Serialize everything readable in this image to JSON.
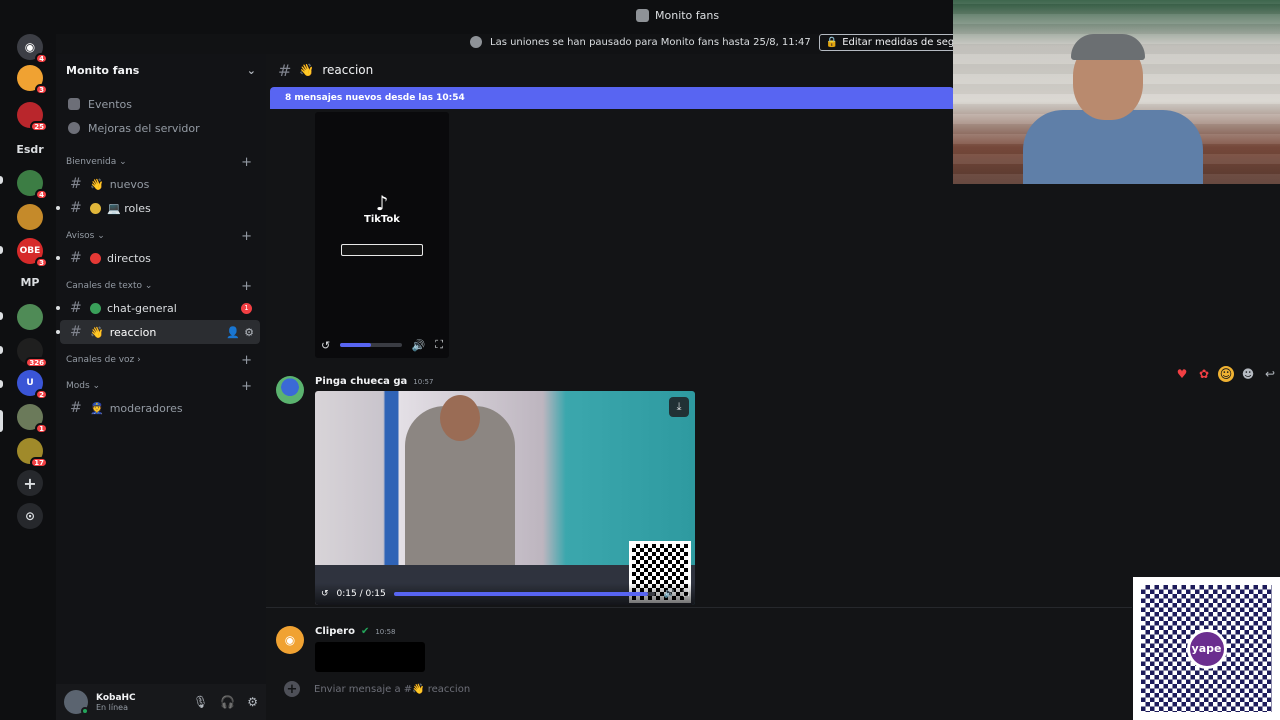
{
  "window": {
    "title": "Monito fans"
  },
  "notice": {
    "text": "Las uniones se han pausado para Monito fans hasta 25/8, 11:47",
    "button": "Editar medidas de seguridad"
  },
  "rail": {
    "servers": [
      {
        "label": "",
        "badge": "4",
        "color": "#5865f2"
      },
      {
        "label": "",
        "badge": "3",
        "color": "#f0a232"
      },
      {
        "label": "",
        "badge": "25",
        "color": "#b9262c"
      },
      {
        "label": "Esdr",
        "badge": "",
        "color": ""
      },
      {
        "label": "",
        "badge": "4",
        "color": "#3c7d44"
      },
      {
        "label": "",
        "badge": "",
        "color": "#c58a2a"
      },
      {
        "label": "OBE",
        "badge": "3",
        "color": "#d62a2a"
      },
      {
        "label": "MP",
        "badge": "",
        "color": ""
      },
      {
        "label": "",
        "badge": "",
        "color": "#4f8b56"
      },
      {
        "label": "",
        "badge": "326",
        "color": "#1f1f1f"
      },
      {
        "label": "U",
        "badge": "2",
        "color": "#3a55d6"
      },
      {
        "label": "",
        "badge": "1",
        "color": "#6b7a5a"
      },
      {
        "label": "",
        "badge": "17",
        "color": "#a08a2a"
      }
    ]
  },
  "sidebar": {
    "server_name": "Monito fans",
    "links": [
      "Eventos",
      "Mejoras del servidor"
    ],
    "categories": [
      {
        "name": "Bienvenida",
        "channels": [
          {
            "name": "nuevos"
          },
          {
            "name": "💻 roles"
          }
        ]
      },
      {
        "name": "Avisos",
        "channels": [
          {
            "name": "directos"
          }
        ]
      },
      {
        "name": "Canales de texto",
        "channels": [
          {
            "name": "chat-general",
            "badge": "1"
          },
          {
            "name": "reaccion"
          }
        ]
      },
      {
        "name": "Canales de voz",
        "channels": []
      },
      {
        "name": "Mods",
        "channels": [
          {
            "name": "moderadores"
          }
        ]
      }
    ]
  },
  "user": {
    "name": "KobaHC",
    "status": "En línea"
  },
  "chat": {
    "channel_name": "reaccion",
    "new_messages": "8 mensajes nuevos desde las 10:54",
    "tiktok_word": "TikTok",
    "messages": [
      {
        "author": "Pinga chueca ga",
        "time": "10:57",
        "video_time": "0:15 / 0:15",
        "progress": 0.97
      },
      {
        "author": "Clipero",
        "time": "10:58"
      }
    ],
    "tiktok_progress": 0.5,
    "composer_placeholder": "Enviar mensaje a #👋 reaccion"
  },
  "qr": {
    "brand": "yape"
  },
  "colors": {
    "accent": "#5865f2",
    "danger": "#f23f43",
    "online": "#23a55a"
  }
}
